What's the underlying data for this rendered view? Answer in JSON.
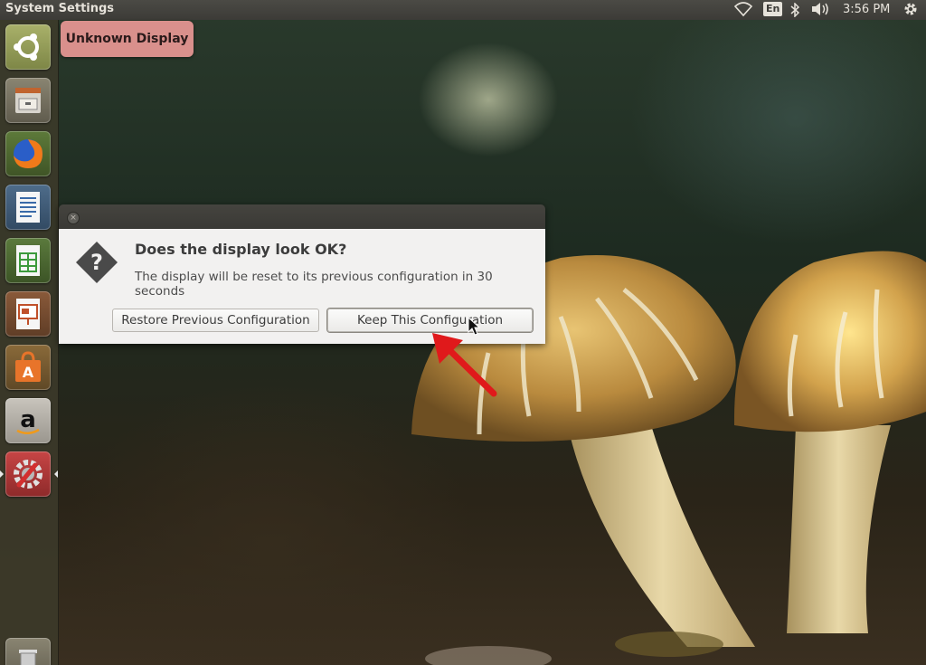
{
  "top_panel": {
    "app_title": "System Settings",
    "keyboard_indicator": "En",
    "clock": "3:56 PM",
    "icons": [
      "wifi-icon",
      "bluetooth-icon",
      "volume-icon",
      "gear-icon"
    ]
  },
  "launcher": {
    "items": [
      {
        "name": "dash-home",
        "icon": "ubuntu-logo-icon"
      },
      {
        "name": "files",
        "icon": "file-cabinet-icon"
      },
      {
        "name": "firefox",
        "icon": "firefox-icon"
      },
      {
        "name": "libreoffice-writer",
        "icon": "writer-icon"
      },
      {
        "name": "libreoffice-calc",
        "icon": "calc-icon"
      },
      {
        "name": "libreoffice-impress",
        "icon": "impress-icon"
      },
      {
        "name": "ubuntu-software-center",
        "icon": "shopping-bag-icon"
      },
      {
        "name": "amazon",
        "icon": "amazon-icon"
      },
      {
        "name": "system-settings",
        "icon": "settings-icon",
        "active": true
      },
      {
        "name": "trash",
        "icon": "trash-icon"
      }
    ]
  },
  "notification": {
    "text": "Unknown Display"
  },
  "dialog": {
    "heading": "Does the display look OK?",
    "message": "The display will be reset to its previous configuration in 30 seconds",
    "restore_button": "Restore Previous Configuration",
    "keep_button": "Keep This Configuration"
  },
  "colors": {
    "panel": "#3c3b37",
    "dialog_bg": "#f2f1f0",
    "notification_bg": "#d9908c",
    "arrow_annotation": "#e0191b"
  }
}
